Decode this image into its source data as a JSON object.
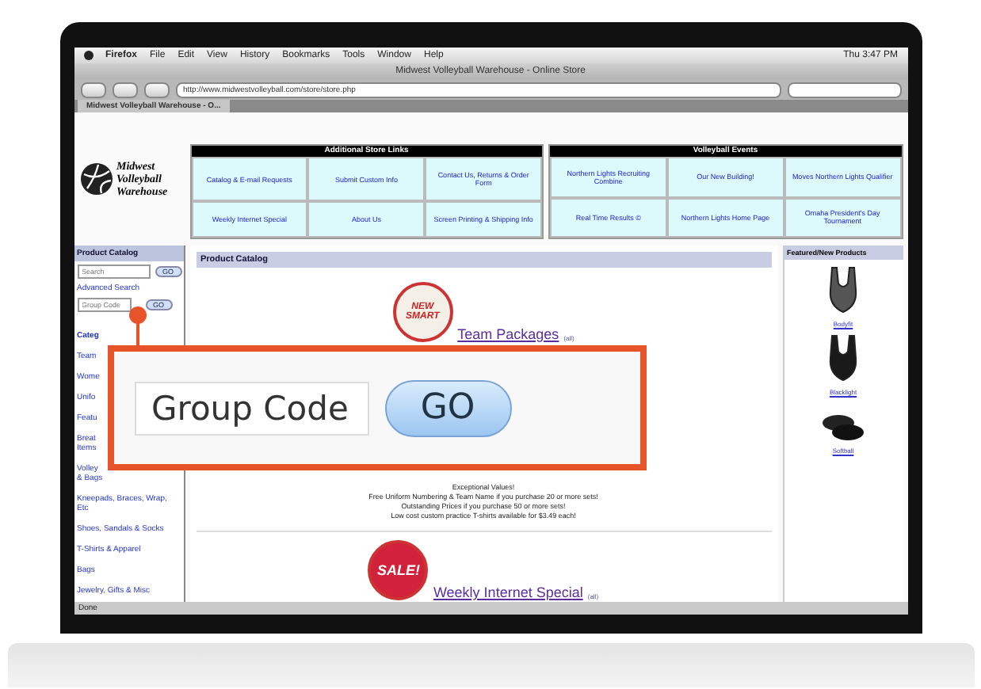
{
  "menu_bar": {
    "app": "Firefox",
    "items": [
      "File",
      "Edit",
      "View",
      "History",
      "Bookmarks",
      "Tools",
      "Window",
      "Help"
    ],
    "clock": "Thu 3:47 PM"
  },
  "window": {
    "title": "Midwest Volleyball Warehouse - Online Store"
  },
  "toolbar": {
    "url": "http://www.midwestvolleyball.com/store/store.php"
  },
  "tabs": [
    {
      "label": "Midwest Volleyball Warehouse - O...",
      "selected": true
    }
  ],
  "logo": {
    "lines": [
      "Midwest",
      "Volleyball",
      "Warehouse"
    ]
  },
  "link_tables": [
    {
      "title": "Additional Store Links",
      "links": [
        "Catalog & E-mail Requests",
        "Submit Custom Info",
        "Contact Us, Returns & Order Form",
        "Weekly Internet Special",
        "About Us",
        "Screen Printing & Shipping Info"
      ]
    },
    {
      "title": "Volleyball Events",
      "links": [
        "Northern Lights Recruiting Combine",
        "Our New Building!",
        "Moves Northern Lights Qualifier",
        "Real Time Results ©",
        "Northern Lights Home Page",
        "Omaha President's Day Tournament"
      ]
    }
  ],
  "sidebar": {
    "title": "Product Catalog",
    "search": {
      "placeholder": "Search",
      "button": "GO"
    },
    "advanced": "Advanced Search",
    "group_code": {
      "placeholder": "Group Code",
      "button": "GO"
    },
    "items": [
      "Categ",
      "Team",
      "Wome",
      "Unifo",
      "Featu",
      "Breat Items",
      "Volley & Bags",
      "Kneepads, Braces, Wrap, Etc",
      "Shoes, Sandals & Socks",
      "T-Shirts & Apparel",
      "Bags",
      "Jewelry, Gifts & Misc"
    ]
  },
  "main": {
    "title": "Product Catalog",
    "sections": [
      {
        "badge": "NEW SMART",
        "link": "Team Packages",
        "more": "(all)"
      },
      {
        "badge": "SALE!",
        "link": "Weekly Internet Special",
        "more": "(all)"
      }
    ],
    "notes": [
      "Exceptional Values!",
      "Free Uniform Numbering & Team Name if you purchase 20 or more sets!",
      "Outstanding Prices if you purchase 50 or more sets!",
      "Low cost custom practice T-shirts available for $3.49 each!"
    ]
  },
  "featured": {
    "title": "Featured/New Products",
    "items": [
      "Bodyfit",
      "Blacklight",
      "Softball"
    ]
  },
  "status_bar": "Done",
  "callout": {
    "placeholder": "Group Code",
    "button": "GO"
  }
}
